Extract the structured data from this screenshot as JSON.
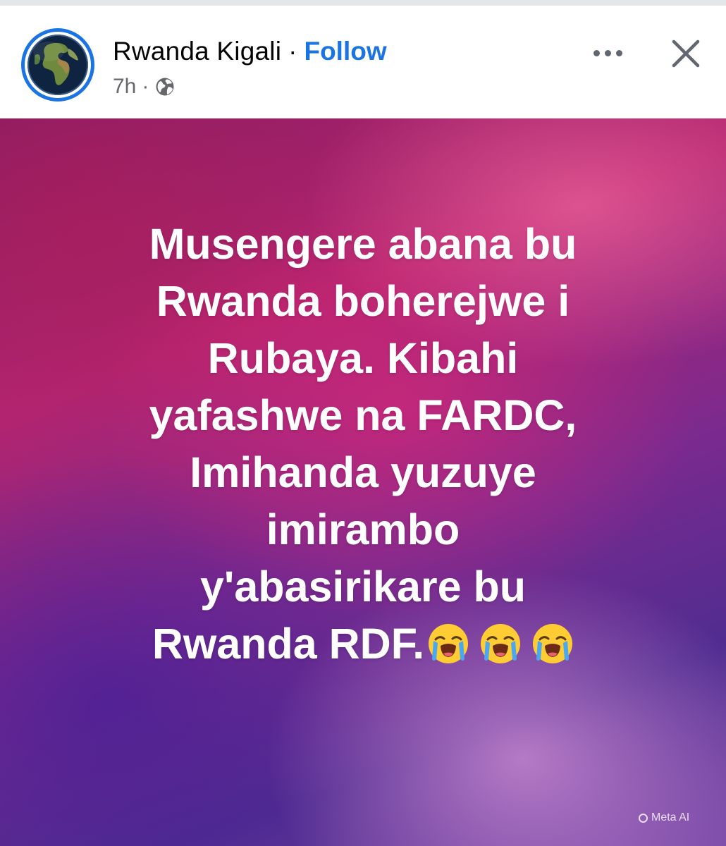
{
  "post": {
    "author": "Rwanda Kigali",
    "separator": "·",
    "follow_label": "Follow",
    "time": "7h",
    "meta_separator": "·",
    "audience_icon": "globe-icon",
    "text_lines": [
      "Musengere abana bu",
      "Rwanda boherejwe i",
      "Rubaya. Kibahi",
      "yafashwe na FARDC,",
      "Imihanda yuzuye",
      "imirambo",
      "y'abasirikare bu",
      "Rwanda RDF."
    ],
    "trailing_emojis": [
      "loudly-crying-face",
      "loudly-crying-face",
      "loudly-crying-face"
    ],
    "watermark": "Meta AI"
  },
  "colors": {
    "accent": "#1b74e4",
    "secondary_text": "#65676b",
    "icon_gray": "#606770"
  }
}
